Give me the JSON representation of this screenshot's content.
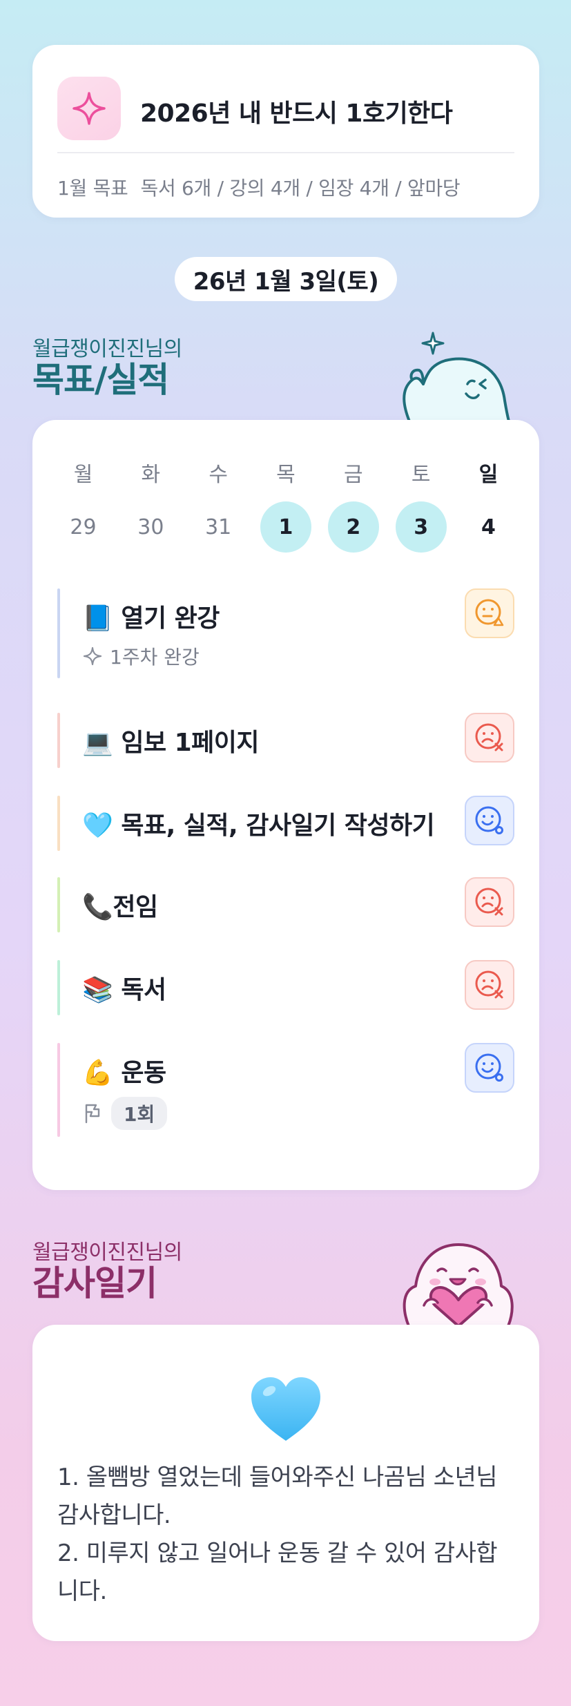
{
  "goal": {
    "title": "2026년 내 반드시 1호기한다",
    "month_label": "1월 목표",
    "items_text": "독서 6개 / 강의 4개 / 임장 4개 / 앞마당",
    "icon": "sparkle-icon"
  },
  "date": "26년 1월 3일(토)",
  "goals_section": {
    "owner": "월급쟁이진진님의",
    "title": "목표/실적"
  },
  "week": {
    "days": [
      {
        "name": "월",
        "num": "29"
      },
      {
        "name": "화",
        "num": "30"
      },
      {
        "name": "수",
        "num": "31"
      },
      {
        "name": "목",
        "num": "1"
      },
      {
        "name": "금",
        "num": "2"
      },
      {
        "name": "토",
        "num": "3"
      },
      {
        "name": "일",
        "num": "4"
      }
    ]
  },
  "tasks": [
    {
      "title": "📘 열기 완강",
      "sub": "1주차 완강",
      "status": "warn",
      "color": "#c9d5f2"
    },
    {
      "title": "💻 임보 1페이지",
      "status": "bad",
      "color": "#f7d0cc"
    },
    {
      "title": "🩵 목표, 실적, 감사일기 작성하기",
      "status": "good",
      "color": "#f9dfc2"
    },
    {
      "title": "📞전임",
      "status": "bad",
      "color": "#d4f0b5"
    },
    {
      "title": "📚 독서",
      "status": "bad",
      "color": "#bdf0d9"
    },
    {
      "title": "💪 운동",
      "chip": "1회",
      "status": "good",
      "color": "#f7c9e3"
    }
  ],
  "gratitude_section": {
    "owner": "월급쟁이진진님의",
    "title": "감사일기"
  },
  "gratitude": {
    "icon": "blue-heart-icon",
    "lines": [
      "1. 올뺌방 열었는데 들어와주신 나곰님 소년님 감사합니다.",
      "2. 미루지 않고 일어나 운동 갈 수 있어 감사합니다."
    ]
  }
}
